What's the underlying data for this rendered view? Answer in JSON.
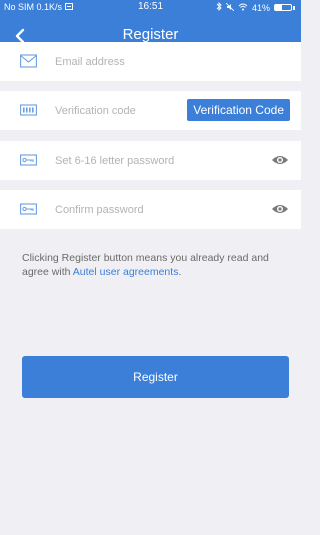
{
  "status_bar": {
    "carrier": "No SIM",
    "speed": "0.1K/s",
    "time": "16:51",
    "battery": "41%",
    "battery_level": 0.41
  },
  "header": {
    "title": "Register"
  },
  "form": {
    "email_placeholder": "Email address",
    "code_placeholder": "Verification code",
    "code_button": "Verification Code",
    "password_placeholder": "Set 6-16 letter password",
    "confirm_placeholder": "Confirm password"
  },
  "agreement": {
    "text": "Clicking Register button means you already read and agree with ",
    "link": "Autel user agreements",
    "suffix": "."
  },
  "register_button": "Register",
  "colors": {
    "accent": "#3b7fd9",
    "background": "#efeff4"
  },
  "icons": {
    "email": "envelope-icon",
    "code": "keypad-icon",
    "password": "key-icon",
    "confirm": "key-icon",
    "eye": "eye-icon",
    "back": "chevron-left-icon"
  }
}
